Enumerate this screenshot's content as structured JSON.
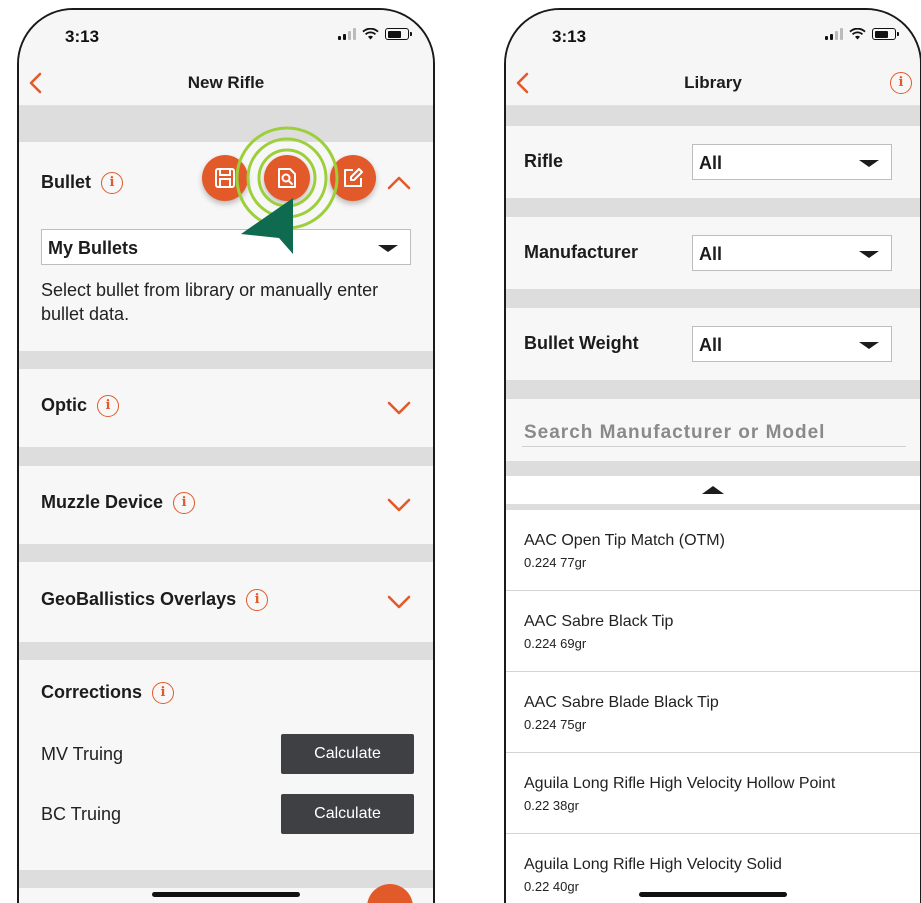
{
  "left_screen": {
    "status_time": "3:13",
    "nav_title": "New Rifle",
    "bullet": {
      "title": "Bullet",
      "selected": "My Bullets",
      "description": "Select bullet from library or manually enter bullet data."
    },
    "optic": {
      "title": "Optic"
    },
    "muzzle": {
      "title": "Muzzle Device"
    },
    "overlays": {
      "title": "GeoBallistics Overlays"
    },
    "corrections": {
      "title": "Corrections",
      "rows": [
        {
          "label": "MV Truing",
          "button": "Calculate"
        },
        {
          "label": "BC Truing",
          "button": "Calculate"
        }
      ]
    }
  },
  "right_screen": {
    "status_time": "3:13",
    "nav_title": "Library",
    "filters": [
      {
        "label": "Rifle",
        "value": "All"
      },
      {
        "label": "Manufacturer",
        "value": "All"
      },
      {
        "label": "Bullet Weight",
        "value": "All"
      }
    ],
    "search_placeholder": "Search Manufacturer or Model",
    "items": [
      {
        "name": "AAC Open Tip Match (OTM)",
        "detail": "0.224 77gr"
      },
      {
        "name": "AAC Sabre Black Tip",
        "detail": "0.224 69gr"
      },
      {
        "name": "AAC Sabre Blade Black Tip",
        "detail": "0.224 75gr"
      },
      {
        "name": "Aguila Long Rifle High Velocity Hollow Point",
        "detail": "0.22 38gr"
      },
      {
        "name": "Aguila Long Rifle High Velocity Solid",
        "detail": "0.22 40gr"
      }
    ]
  },
  "colors": {
    "accent": "#e35a2a",
    "pointer": "#0f6b4f",
    "highlight_ring": "#9ccf3a",
    "button_dark": "#3e4043"
  },
  "icons": [
    "back-chevron-icon",
    "info-icon",
    "save-icon",
    "search-library-icon",
    "edit-icon",
    "chevron-up-icon",
    "chevron-down-icon",
    "dropdown-arrow-icon",
    "pointer-cursor-icon"
  ]
}
